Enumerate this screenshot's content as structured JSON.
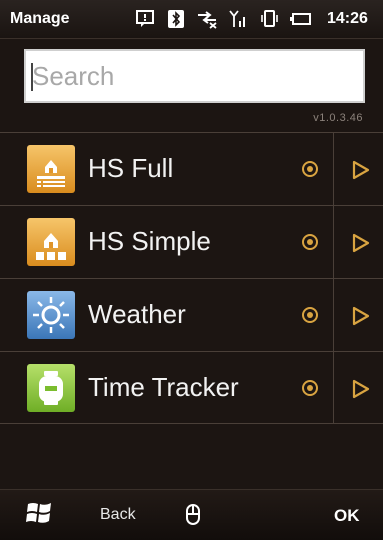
{
  "status_bar": {
    "title": "Manage",
    "time": "14:26",
    "icons": [
      "notification-icon",
      "bluetooth-icon",
      "data-connection-icon",
      "signal-icon",
      "vibrate-icon",
      "battery-icon"
    ]
  },
  "search": {
    "placeholder": "Search",
    "value": ""
  },
  "version": "v1.0.3.46",
  "apps": [
    {
      "label": "HS Full",
      "icon": "hs-full-icon",
      "color": "#e3a13c"
    },
    {
      "label": "HS Simple",
      "icon": "hs-simple-icon",
      "color": "#e3a13c"
    },
    {
      "label": "Weather",
      "icon": "weather-icon",
      "color": "#4d89c9"
    },
    {
      "label": "Time Tracker",
      "icon": "time-tracker-icon",
      "color": "#8cc63f"
    }
  ],
  "softkeys": {
    "back": "Back",
    "ok": "OK"
  },
  "accent": "#d9a441"
}
